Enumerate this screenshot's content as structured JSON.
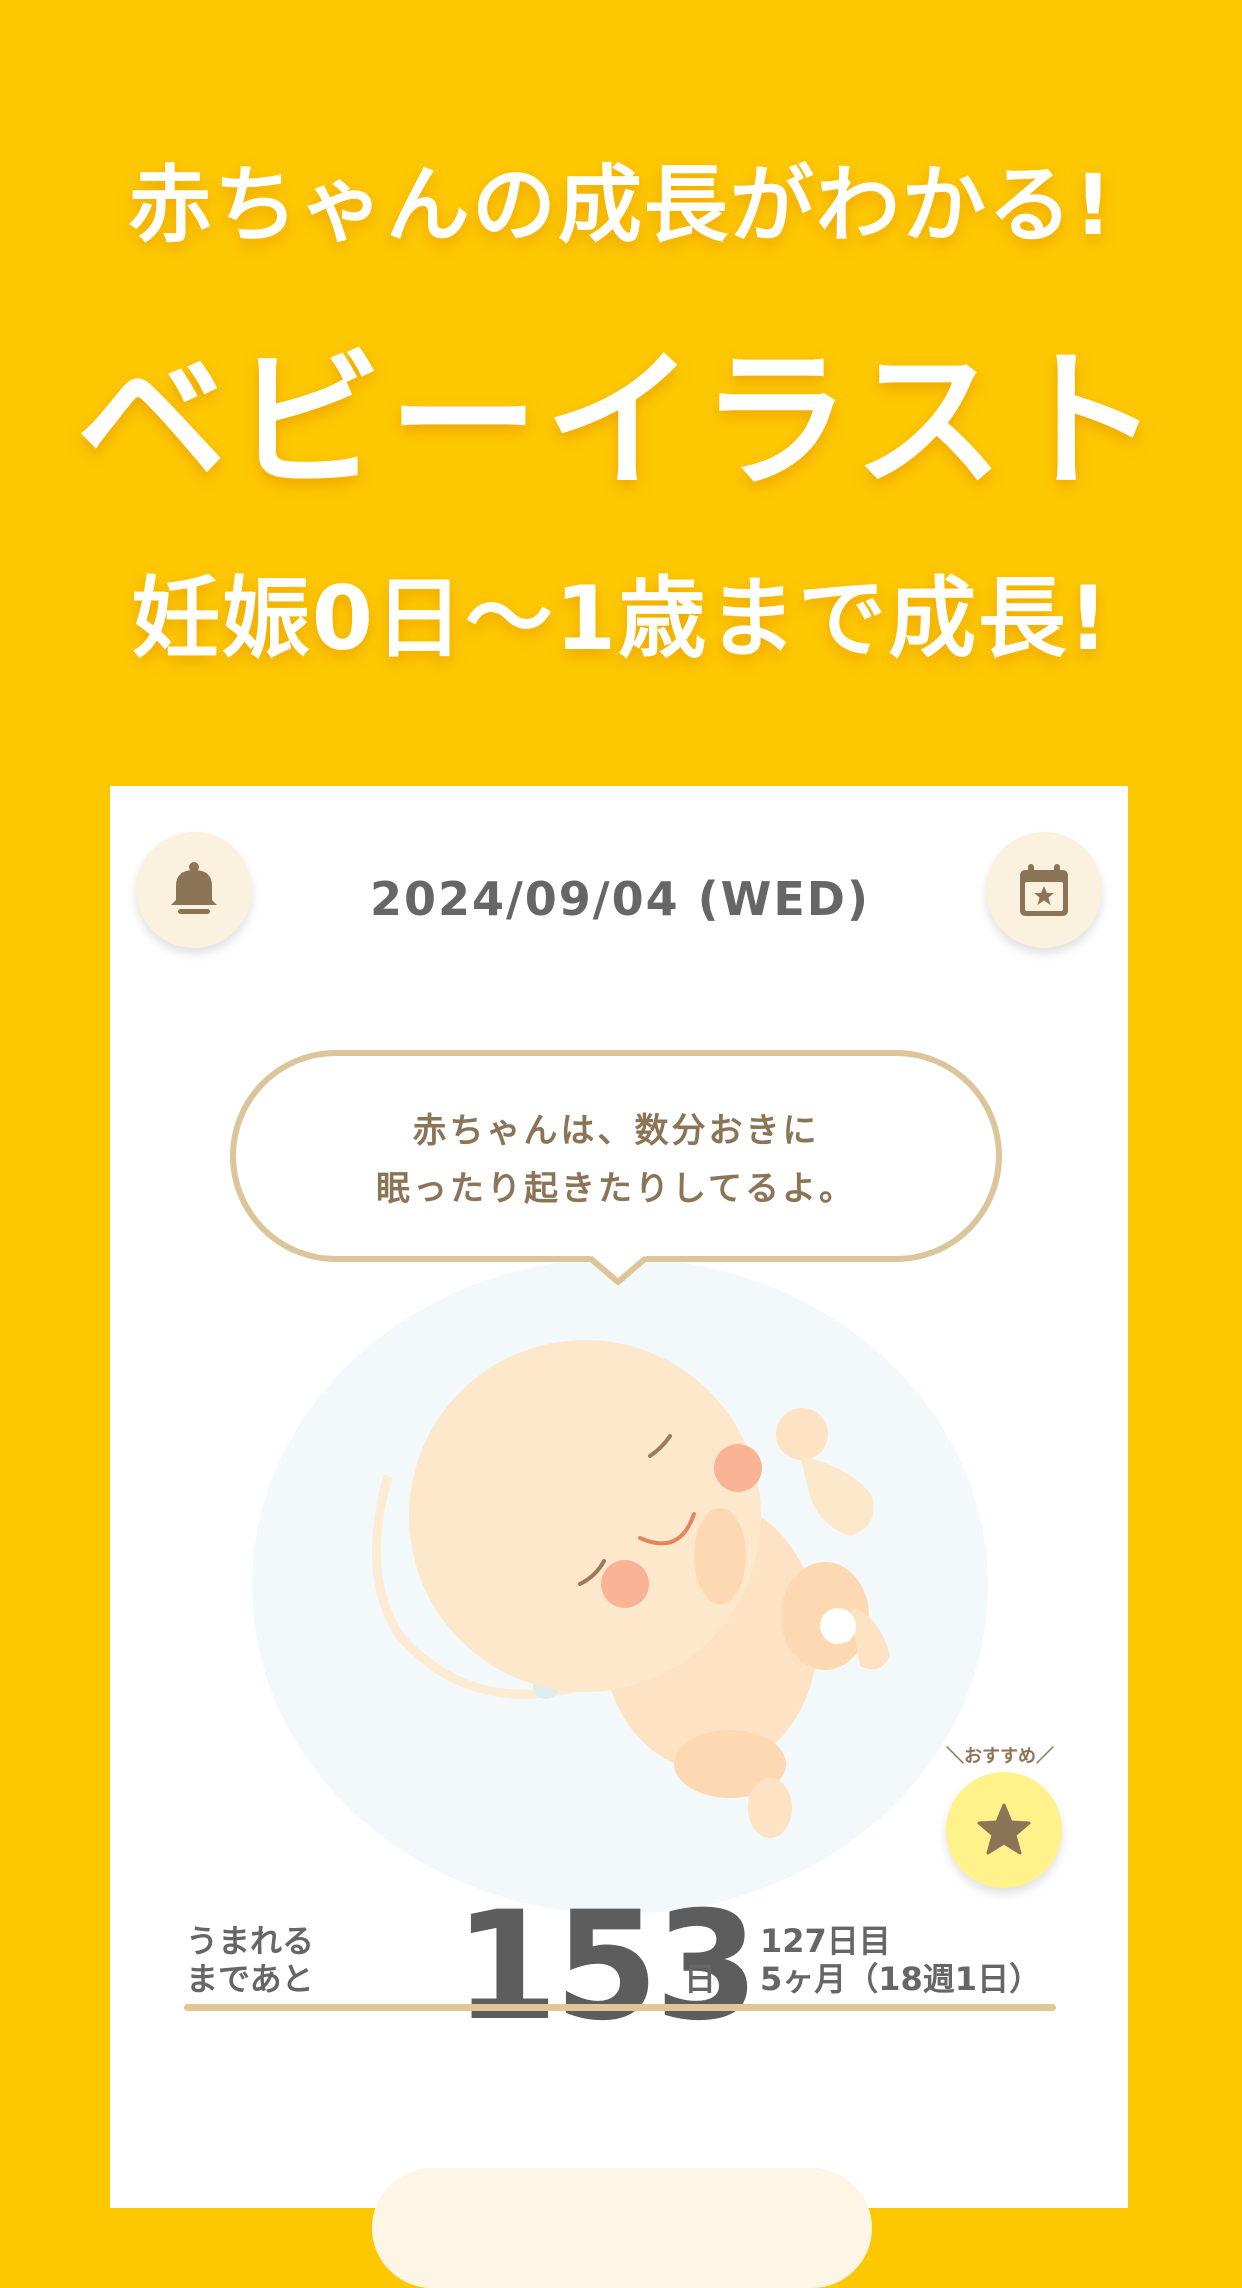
{
  "hero": {
    "line1": "赤ちゃんの成長がわかる!",
    "line2": "ベビーイラスト",
    "line3": "妊娠0日〜1歳まで成長!"
  },
  "card": {
    "date": "2024/09/04 (WED)",
    "bubble": {
      "line1": "赤ちゃんは、数分おきに",
      "line2": "眠ったり起きたりしてるよ。"
    },
    "recommend_caption": "＼おすすめ／",
    "countdown": {
      "label_line1": "うまれる",
      "label_line2": "まであと",
      "value": "153",
      "unit": "日",
      "day_count": "127日目",
      "age": "5ヶ月（18週1日）"
    }
  },
  "icons": {
    "bell": "bell-icon",
    "calendar": "calendar-star-icon",
    "recommend": "star-icon"
  },
  "colors": {
    "background": "#FDC802",
    "accent_brown": "#8C7457",
    "bubble_border": "#DCC59B",
    "recommend_bg": "#FFF28A"
  }
}
